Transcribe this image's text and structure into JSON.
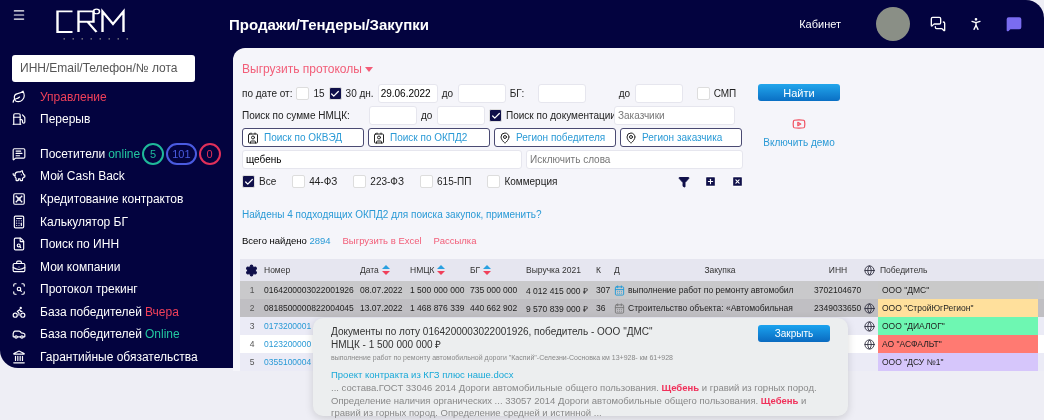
{
  "sidebar": {
    "search": {
      "placeholder": "ИНН/Email/Телефон/№ лота"
    },
    "items": [
      {
        "label": "Управление",
        "color": "#f0405a"
      },
      {
        "label": "Перерыв"
      },
      {
        "label": "Посетители",
        "suffix": {
          "text": "online",
          "color": "#22c7a0"
        },
        "badges": [
          {
            "text": "5",
            "color": "#1fb99a"
          },
          {
            "text": "101",
            "color": "#4a5be0"
          },
          {
            "text": "0",
            "color": "#e0305a"
          }
        ]
      },
      {
        "label": "Мой Cash Back"
      },
      {
        "label": "Кредитование контрактов"
      },
      {
        "label": "Калькулятор БГ"
      },
      {
        "label": "Поиск по ИНН"
      },
      {
        "label": "Мои компании"
      },
      {
        "label": "Протокол трекинг"
      },
      {
        "label": "База победителей",
        "suffix": {
          "text": "Вчера",
          "color": "#f0405a"
        }
      },
      {
        "label": "База победителей",
        "suffix": {
          "text": "Online",
          "color": "#22c7a0"
        }
      },
      {
        "label": "Гарантийные обязательства"
      }
    ]
  },
  "header": {
    "title": "Продажи/Тендеры/Закупки",
    "cabinet": "Кабинет"
  },
  "export_protocols": "Выгрузить протоколы",
  "filters": {
    "row1": {
      "date_label": "по дате от:",
      "periods": [
        {
          "label": "15",
          "checked": false
        },
        {
          "label": "30 дн.",
          "checked": true
        }
      ],
      "date_from": "29.06.2022",
      "to_label": "до",
      "bg_label": "БГ:",
      "bg_to_label": "до",
      "smp": {
        "label": "СМП",
        "checked": false
      }
    },
    "row2": {
      "sum_label": "Поиск по сумме НМЦК:",
      "to_label": "до",
      "docs": {
        "label": "Поиск по документации",
        "checked": true
      },
      "customers": {
        "placeholder": "Заказчики"
      }
    },
    "pickers": [
      {
        "kind": "category",
        "label": "Поиск по ОКВЭД"
      },
      {
        "kind": "category",
        "label": "Поиск по ОКПД2"
      },
      {
        "kind": "region",
        "label": "Регион победителя"
      },
      {
        "kind": "region",
        "label": "Регион заказчика"
      }
    ],
    "keywords": {
      "value": "щебень"
    },
    "exclude": {
      "placeholder": "Исключить слова"
    },
    "laws": [
      {
        "label": "Все",
        "checked": true
      },
      {
        "label": "44-ФЗ",
        "checked": false
      },
      {
        "label": "223-ФЗ",
        "checked": false
      },
      {
        "label": "615-ПП",
        "checked": false
      },
      {
        "label": "Коммерция",
        "checked": false
      }
    ]
  },
  "find_button": "Найти",
  "demo_link": "Включить демо",
  "okpd_hint": "Найдены 4 подходящих ОКПД2 для поиска закупок, применить?",
  "summary": {
    "label": "Всего найдено",
    "count": "2894",
    "actions": [
      "Выгрузить в Excel",
      "Рассылка"
    ]
  },
  "table": {
    "columns": [
      {
        "label": "Номер",
        "sortable": false
      },
      {
        "label": "Дата",
        "sortable": true
      },
      {
        "label": "НМЦК",
        "sortable": true
      },
      {
        "label": "БГ",
        "sortable": true
      },
      {
        "label": "Выручка 2021",
        "sortable": false
      },
      {
        "label": "К",
        "sortable": false
      },
      {
        "label": "Д",
        "sortable": false
      },
      {
        "label": "Закупка",
        "sortable": false
      },
      {
        "label": "ИНН",
        "sortable": false
      },
      {
        "label": "Победитель",
        "sortable": false
      }
    ],
    "rows": [
      {
        "index": "1",
        "lot": "0164200003022001926",
        "date": "08.07.2022",
        "nmck": "1 500 000 000",
        "bg": "735 000 000",
        "revenue": "4 012 415 000 ₽",
        "k": "307",
        "documents": true,
        "purchase": "выполнение работ по ремонту автомобил",
        "inn": "3702104670",
        "web": false,
        "winner": "ООО \"ДМС\"",
        "color": "#c9c9c9",
        "highlighted": true
      },
      {
        "index": "2",
        "lot": "0818500000822004045",
        "date": "13.07.2022",
        "nmck": "1 468 876 339",
        "bg": "440 662 902",
        "revenue": "9 570 839 000 ₽",
        "k": "36",
        "documents": false,
        "purchase": "Строительство объекта: «Автомобильная",
        "inn": "2349033650",
        "web": true,
        "winner": "ООО \"СтройЮгРегион\"",
        "color": "#ffe09c",
        "highlighted": true
      },
      {
        "index": "3",
        "lot": "0173200001",
        "web": true,
        "winner": "ООО \"ДИАЛОГ\"",
        "color": "#6ef7b2",
        "highlighted": false
      },
      {
        "index": "4",
        "lot": "0123200000",
        "web": true,
        "winner": "АО \"АСФАЛЬТ\"",
        "color": "#ff7a72",
        "highlighted": false
      },
      {
        "index": "5",
        "lot": "0355100004",
        "web": false,
        "winner": "ООО \"ДСУ №1\"",
        "color": "#d6c6fb",
        "highlighted": false
      }
    ]
  },
  "popup": {
    "title": "Документы по лоту 0164200003022001926, победитель - ООО \"ДМС\"",
    "price": "НМЦК - 1 500 000 000 ₽",
    "description": "выполнение работ по ремонту автомобильной дороги \"Каспий\"-Селезни-Сосновка км 13+928- км 61+928",
    "close": "Закрыть",
    "file": "Проект контракта из КГЗ плюс наше.docx",
    "snippet": "... состава.ГОСТ 33046 2014 Дороги автомобильные общего пользования. **Щебень** и гравий из горных пород. Определение наличия органических ... 33057 2014 Дороги автомобильные общего пользования. **Щебень** и гравий из горных пород. Определение средней и истинной ..."
  }
}
